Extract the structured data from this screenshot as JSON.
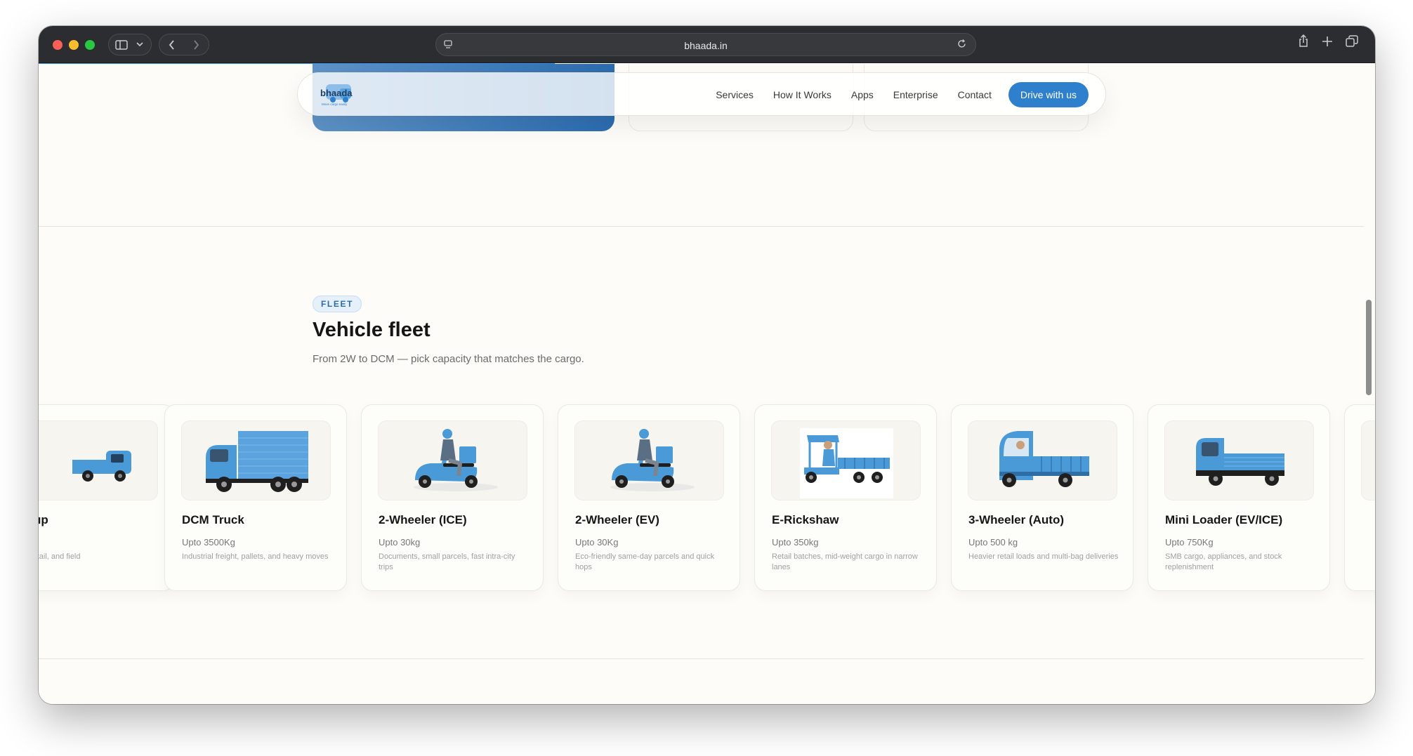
{
  "browser": {
    "url": "bhaada.in"
  },
  "header": {
    "logo_text": "bhaada",
    "logo_tagline": "Move cargo easily",
    "nav": [
      "Services",
      "How It Works",
      "Apps",
      "Enterprise",
      "Contact"
    ],
    "cta": "Drive with us"
  },
  "fleet": {
    "badge": "FLEET",
    "title": "Vehicle fleet",
    "subtitle": "From 2W to DCM — pick capacity that matches the cargo.",
    "cards": [
      {
        "title": "Pickup",
        "capacity": "",
        "desc": "Bulky retail, and field"
      },
      {
        "title": "DCM Truck",
        "capacity": "Upto 3500Kg",
        "desc": "Industrial freight, pallets, and heavy moves"
      },
      {
        "title": "2-Wheeler (ICE)",
        "capacity": "Upto 30kg",
        "desc": "Documents, small parcels, fast intra-city trips"
      },
      {
        "title": "2-Wheeler (EV)",
        "capacity": "Upto 30Kg",
        "desc": "Eco-friendly same-day parcels and quick hops"
      },
      {
        "title": "E-Rickshaw",
        "capacity": "Upto 350kg",
        "desc": "Retail batches, mid-weight cargo in narrow lanes"
      },
      {
        "title": "3-Wheeler (Auto)",
        "capacity": "Upto 500 kg",
        "desc": "Heavier retail loads and multi-bag deliveries"
      },
      {
        "title": "Mini Loader (EV/ICE)",
        "capacity": "Upto 750Kg",
        "desc": "SMB cargo, appliances, and stock replenishment"
      },
      {
        "title": "",
        "capacity": "",
        "desc": ""
      }
    ]
  },
  "colors": {
    "accent": "#2f80cc",
    "vehicle_blue": "#4a9ad8",
    "page_bg": "#fdfcf8"
  }
}
